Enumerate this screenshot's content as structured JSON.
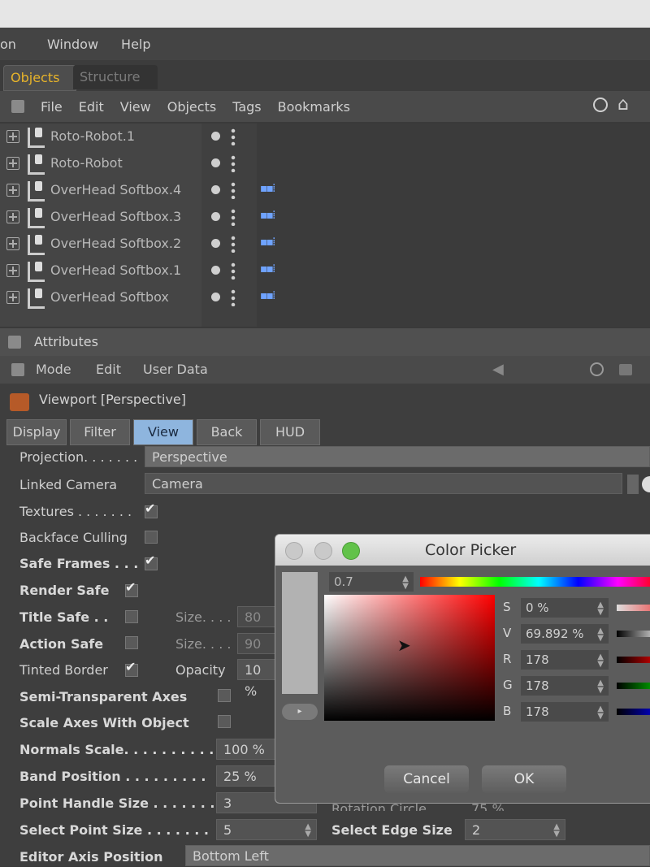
{
  "menubar": {
    "items": [
      "on",
      "Window",
      "Help"
    ]
  },
  "tabs": {
    "objects": "Objects",
    "structure": "Structure"
  },
  "object_menu": {
    "items": [
      "File",
      "Edit",
      "View",
      "Objects",
      "Tags",
      "Bookmarks"
    ]
  },
  "objects": [
    {
      "label": "Roto-Robot.1",
      "tag": ""
    },
    {
      "label": "Roto-Robot",
      "tag": ""
    },
    {
      "label": "OverHead Softbox.4",
      "tag": "tag"
    },
    {
      "label": "OverHead Softbox.3",
      "tag": "tag"
    },
    {
      "label": "OverHead Softbox.2",
      "tag": "tag"
    },
    {
      "label": "OverHead Softbox.1",
      "tag": "tag"
    },
    {
      "label": "OverHead Softbox",
      "tag": "tag"
    }
  ],
  "attributes": {
    "header": "Attributes",
    "menu": [
      "Mode",
      "Edit",
      "User Data"
    ],
    "title": "Viewport [Perspective]",
    "tabs": [
      "Display",
      "Filter",
      "View",
      "Back",
      "HUD"
    ],
    "active_tab": "View",
    "projection_label": "Projection. . . . . . .",
    "projection_value": "Perspective",
    "linked_camera_label": "Linked Camera",
    "linked_camera_value": "Camera",
    "textures_label": "Textures . . . . . . .",
    "backface_label": "Backface Culling",
    "safe_frames_label": "Safe Frames . . .",
    "render_safe_label": "Render Safe",
    "title_safe_label": "Title Safe . .",
    "action_safe_label": "Action Safe",
    "tinted_border_label": "Tinted Border",
    "size_label": "Size. . . .",
    "size_value_1": "80",
    "size_value_2": "90",
    "opacity_label": "Opacity",
    "opacity_value": "10 %",
    "semi_axes_label": "Semi-Transparent Axes",
    "scale_axes_label": "Scale Axes With Object",
    "normals_scale_label": "Normals Scale. . . . . . . . . .",
    "normals_scale_value": "100 %",
    "band_position_label": "Band Position . . . . . . . . .",
    "band_position_value": "25 %",
    "point_handle_label": "Point Handle Size . . . . . . .",
    "point_handle_value": "3",
    "rotation_circle_label": "Rotation Circle",
    "rotation_circle_value": "75 %",
    "select_point_label": "Select Point Size . . . . . . .",
    "select_point_value": "5",
    "select_edge_label": "Select Edge Size",
    "select_edge_value": "2",
    "editor_axis_label": "Editor Axis Position",
    "editor_axis_value": "Bottom Left"
  },
  "color_picker": {
    "title": "Color Picker",
    "hex_value": "0.7",
    "S_label": "S",
    "S_value": "0 %",
    "V_label": "V",
    "V_value": "69.892 %",
    "R_label": "R",
    "R_value": "178",
    "G_label": "G",
    "G_value": "178",
    "B_label": "B",
    "B_value": "178",
    "cancel": "Cancel",
    "ok": "OK",
    "swatch_color": "#b2b2b2"
  }
}
